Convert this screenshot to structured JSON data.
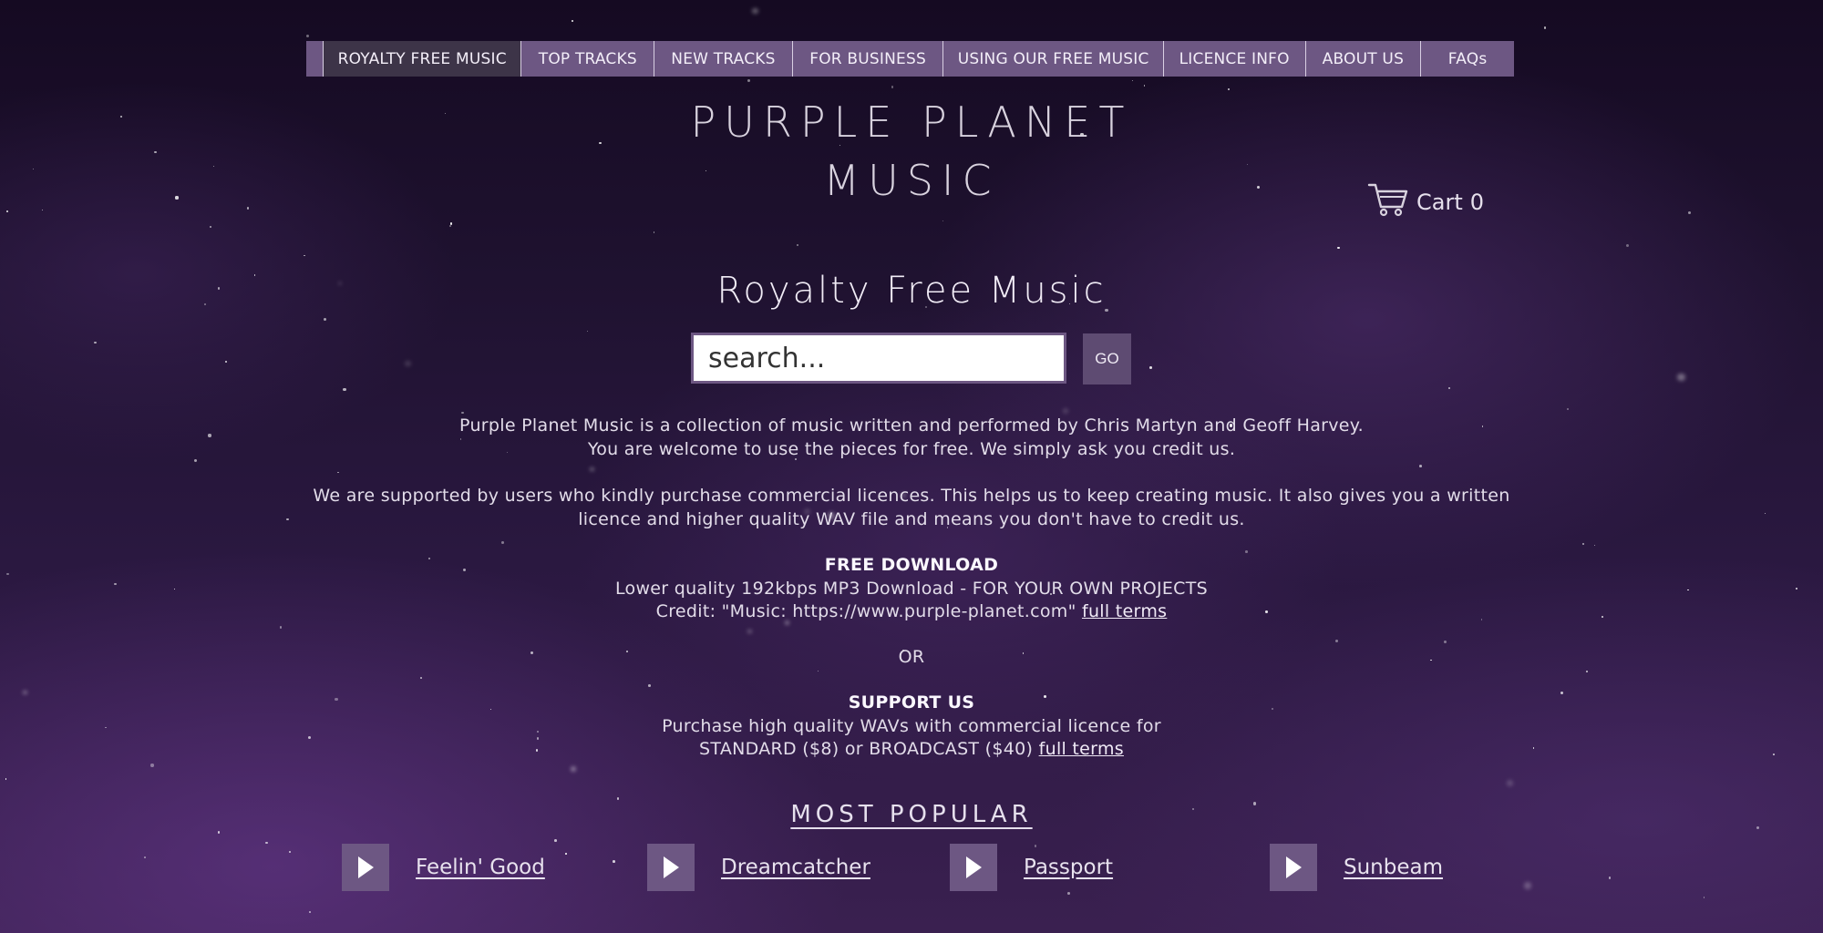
{
  "nav": {
    "items": [
      {
        "label": "ROYALTY FREE MUSIC",
        "active": true
      },
      {
        "label": "TOP TRACKS",
        "active": false
      },
      {
        "label": "NEW TRACKS",
        "active": false
      },
      {
        "label": "FOR BUSINESS",
        "active": false
      },
      {
        "label": "USING OUR FREE MUSIC",
        "active": false
      },
      {
        "label": "LICENCE INFO",
        "active": false
      },
      {
        "label": "ABOUT US",
        "active": false
      },
      {
        "label": "FAQs",
        "active": false
      }
    ]
  },
  "header": {
    "title_line1": "PURPLE PLANET",
    "title_line2": "MUSIC"
  },
  "cart": {
    "label": "Cart",
    "count": "0",
    "icon": "cart-icon"
  },
  "page": {
    "heading": "Royalty Free Music"
  },
  "search": {
    "placeholder": "search...",
    "value": "",
    "go_label": "GO"
  },
  "intro": {
    "line1": "Purple Planet Music is a collection of music written and performed by Chris Martyn and Geoff Harvey.",
    "line2": "You are welcome to use the pieces for free. We simply ask you credit us.",
    "support_line1": "We are supported by users who kindly purchase commercial licences. This helps us to keep creating music. It also gives you a written",
    "support_line2": "licence and higher quality WAV file and means you don't have to credit us."
  },
  "free_download": {
    "heading": "FREE DOWNLOAD",
    "line1": "Lower quality 192kbps MP3 Download - FOR YOUR OWN PROJECTS",
    "credit": "Credit: \"Music: https://www.purple-planet.com\"",
    "terms_link": "full terms"
  },
  "or_text": "OR",
  "support": {
    "heading": "SUPPORT US",
    "line1": "Purchase high quality WAVs with commercial licence for",
    "line2": "STANDARD ($8) or BROADCAST ($40)",
    "terms_link": "full terms"
  },
  "most_popular": {
    "heading": "MOST POPULAR",
    "tracks": [
      {
        "name": "Feelin' Good"
      },
      {
        "name": "Dreamcatcher"
      },
      {
        "name": "Passport"
      },
      {
        "name": "Sunbeam"
      }
    ]
  },
  "colors": {
    "nav_bg": "#6d5783",
    "nav_active_bg": "#3d3448",
    "button_bg": "#5e4b72",
    "background_top": "#150a22",
    "background_bottom": "#3a2050"
  }
}
